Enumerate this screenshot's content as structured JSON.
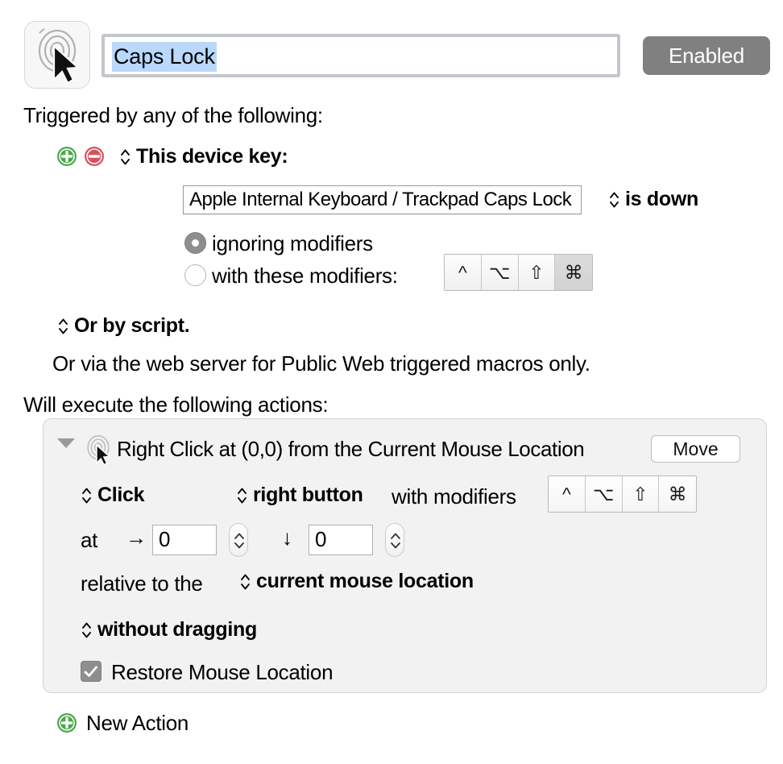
{
  "header": {
    "macro_icon": "mouse-click-icon",
    "title_value": "Caps Lock",
    "enabled_label": "Enabled"
  },
  "triggers": {
    "section_label": "Triggered by any of the following:",
    "add_icon": "plus-circle-icon",
    "remove_icon": "minus-circle-icon",
    "trigger_type": "This device key:",
    "device_value": "Apple Internal Keyboard / Trackpad Caps Lock",
    "key_state": "is down",
    "radio_ignoring": "ignoring modifiers",
    "radio_with_mods": "with these modifiers:",
    "radio_selected": "ignoring",
    "modifiers": [
      {
        "glyph": "^",
        "name": "control-modifier",
        "selected": false
      },
      {
        "glyph": "⌥",
        "name": "option-modifier",
        "selected": false
      },
      {
        "glyph": "⇧",
        "name": "shift-modifier",
        "selected": false
      },
      {
        "glyph": "⌘",
        "name": "command-modifier",
        "selected": true
      }
    ],
    "or_by_script": "Or by script.",
    "web_server_note": "Or via the web server for Public Web triggered macros only."
  },
  "actions": {
    "section_label": "Will execute the following actions:",
    "action": {
      "title": "Right Click at (0,0) from the Current Mouse Location",
      "move_label": "Move",
      "click_popup": "Click",
      "button_popup": "right button",
      "with_modifiers_label": "with modifiers",
      "modifiers": [
        {
          "glyph": "^",
          "name": "control-modifier",
          "selected": false
        },
        {
          "glyph": "⌥",
          "name": "option-modifier",
          "selected": false
        },
        {
          "glyph": "⇧",
          "name": "shift-modifier",
          "selected": false
        },
        {
          "glyph": "⌘",
          "name": "command-modifier",
          "selected": false
        }
      ],
      "at_label": "at",
      "x_arrow": "→",
      "x_value": "0",
      "y_arrow": "↓",
      "y_value": "0",
      "relative_label": "relative to the",
      "relative_popup": "current mouse location",
      "dragging_popup": "without dragging",
      "restore_checkbox_label": "Restore Mouse Location",
      "restore_checked": true
    },
    "new_action_label": "New Action",
    "new_action_icon": "plus-circle-icon"
  },
  "colors": {
    "enabled_bg": "#808080",
    "selection_blue": "#b9d8fb",
    "add_green": "#4aa84a",
    "remove_red": "#d94f5c",
    "panel_bg": "#f2f2f2"
  }
}
